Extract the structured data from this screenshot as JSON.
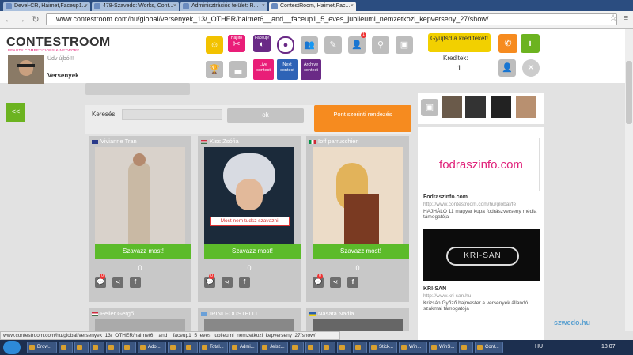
{
  "browser": {
    "tabs": [
      {
        "label": "Devel-CR, Haimet,Faceup1...",
        "active": false
      },
      {
        "label": "478-Szavedo: Works, Cont...",
        "active": false
      },
      {
        "label": "Adminisztrációs felület: R...",
        "active": false
      },
      {
        "label": "ContestRoom, Haimet,Fac...",
        "active": true
      }
    ],
    "url": "www.contestroom.com/hu/global/versenyek_13/_OTHER/hairnet6__and__faceup1_5_eves_jubileumi_nemzetkozi_kepverseny_27/show/",
    "star": "☆",
    "menu": "≡"
  },
  "header": {
    "logo": "CONTESTROOM",
    "logo_sub": "BEAUTY COMPETITIONS & NETWORK",
    "greeting": "Üdv újból!!",
    "username": "Versenyek",
    "icons": [
      {
        "name": "smiley-icon",
        "glyph": "☺"
      },
      {
        "name": "scissors-icon",
        "label": "Hajlító",
        "glyph": "✂"
      },
      {
        "name": "mask-icon",
        "label": "Faceup!",
        "glyph": "◐"
      },
      {
        "name": "badge-icon",
        "glyph": "●"
      },
      {
        "name": "people-icon",
        "glyph": "👥"
      },
      {
        "name": "edit-icon",
        "glyph": "✎"
      },
      {
        "name": "group-icon",
        "glyph": "👤",
        "badge": "1"
      },
      {
        "name": "search-user-icon",
        "glyph": "⚲"
      },
      {
        "name": "gallery-icon",
        "glyph": "▣"
      }
    ],
    "row2": [
      {
        "name": "trophy-icon",
        "glyph": "🏆"
      },
      {
        "name": "podium-icon",
        "glyph": "▃"
      },
      {
        "name": "live-contest-button",
        "label": "Live contest"
      },
      {
        "name": "next-contest-button",
        "label": "Next contest"
      },
      {
        "name": "archive-contest-button",
        "label": "Archive contest"
      }
    ],
    "collect_credit": "Gyűjtsd a kreditekét!",
    "credits_label": "Kreditek:",
    "credits_value": "1",
    "colors": {
      "accent_orange": "#f68b1f",
      "accent_green": "#6cb320",
      "pink": "#e91e78",
      "purple": "#6a2a86"
    }
  },
  "sidebar_left": {
    "back": "<<"
  },
  "search": {
    "label": "Keresés:",
    "value": "",
    "ok": "ok",
    "sort_button": "Pont szerinti rendezés"
  },
  "cards": [
    {
      "name": "Vivianne Tran",
      "vote": "Szavazz most!",
      "count": "0",
      "badge": "0"
    },
    {
      "name": "Kiss Zsófia",
      "vote": "Szavazz most!",
      "count": "0",
      "badge": "0",
      "overlay": "Most nem tudsz szavazni!"
    },
    {
      "name": "Ioff parrucchieri",
      "vote": "Szavazz most!",
      "count": "0",
      "badge": "0"
    },
    {
      "name": "Peller Gergő"
    },
    {
      "name": "IRINI FOUSTELLI"
    },
    {
      "name": "Nasata Nadia"
    }
  ],
  "sponsors": [
    {
      "logo": "fodraszinfo.com",
      "title": "Fodraszinfo.com",
      "url": "http://www.contestroom.com/hu/global/fe",
      "desc": "HAJHÁLÓ 11 magyar kupa fodrászverseny média támogatója"
    },
    {
      "logo": "KRI-SAN",
      "title": "KRI-SAN",
      "url": "http://www.kri-san.hu",
      "desc": "Krizsán Győző hajmester a versenyek állandó szakmai támogatója"
    }
  ],
  "statusbar": "www.contestroom.com/hu/global/versenyek_13/_OTHER/hairnet6__and__faceup1_5_eves_jubileumi_nemzetkozi_kepverseny_27/show/",
  "taskbar": {
    "items": [
      "Brow...",
      "",
      "Ado...",
      "",
      "Total...",
      "Admi...",
      "Jelsz...",
      "",
      "",
      "Stick...",
      "Win...",
      "WinS...",
      "",
      "Cont..."
    ],
    "lang": "HU",
    "clock": "18:07"
  },
  "watermark": "szwedo.hu"
}
